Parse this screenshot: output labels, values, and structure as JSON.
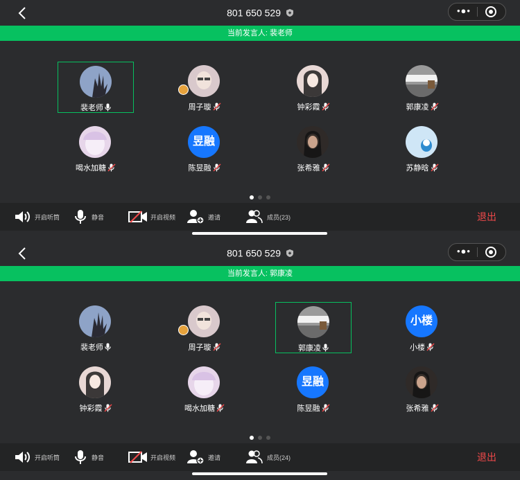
{
  "screens": [
    {
      "meeting_id": "801 650 529",
      "speaker_text": "当前发言人: 裴老师",
      "participants": [
        {
          "name": "裴老师",
          "mic": "on",
          "active": true,
          "avatar": "photo-hand",
          "color": "#8ea3c7"
        },
        {
          "name": "周子璇",
          "mic": "off",
          "active": false,
          "avatar": "photo-girl",
          "color": "#d9c9cc",
          "badge": true
        },
        {
          "name": "钟彩霞",
          "mic": "off",
          "active": false,
          "avatar": "photo-drawn-girl",
          "color": "#e8d8d5"
        },
        {
          "name": "郭康凌",
          "mic": "off",
          "active": false,
          "avatar": "photo-gray",
          "color": "#9a9a9a"
        },
        {
          "name": "喝水加糖",
          "mic": "off",
          "active": false,
          "avatar": "photo-anime",
          "color": "#e7d6ea"
        },
        {
          "name": "陈昱融",
          "mic": "off",
          "active": false,
          "avatar": "text",
          "avatar_text": "昱融"
        },
        {
          "name": "张希雅",
          "mic": "off",
          "active": false,
          "avatar": "photo-dark",
          "color": "#2f2a28"
        },
        {
          "name": "苏静晗",
          "mic": "off",
          "active": false,
          "avatar": "photo-cartoon",
          "color": "#cfe6f6"
        }
      ],
      "toolbar": {
        "speaker_label": "开启听筒",
        "mute_label": "静音",
        "video_label": "开启视频",
        "invite_label": "邀请",
        "members_label": "成员(23)",
        "exit_label": "退出"
      }
    },
    {
      "meeting_id": "801 650 529",
      "speaker_text": "当前发言人: 郭康凌",
      "participants": [
        {
          "name": "裴老师",
          "mic": "on",
          "active": false,
          "avatar": "photo-hand",
          "color": "#8ea3c7"
        },
        {
          "name": "周子璇",
          "mic": "off",
          "active": false,
          "avatar": "photo-girl",
          "color": "#d9c9cc",
          "badge": true
        },
        {
          "name": "郭康凌",
          "mic": "on",
          "active": true,
          "avatar": "photo-gray",
          "color": "#9a9a9a"
        },
        {
          "name": "小楼",
          "mic": "off",
          "active": false,
          "avatar": "text",
          "avatar_text": "小楼"
        },
        {
          "name": "钟彩霞",
          "mic": "off",
          "active": false,
          "avatar": "photo-drawn-girl",
          "color": "#e8d8d5"
        },
        {
          "name": "喝水加糖",
          "mic": "off",
          "active": false,
          "avatar": "photo-anime",
          "color": "#e7d6ea"
        },
        {
          "name": "陈昱融",
          "mic": "off",
          "active": false,
          "avatar": "text",
          "avatar_text": "昱融"
        },
        {
          "name": "张希雅",
          "mic": "off",
          "active": false,
          "avatar": "photo-dark",
          "color": "#2f2a28"
        }
      ],
      "toolbar": {
        "speaker_label": "开启听筒",
        "mute_label": "静音",
        "video_label": "开启视频",
        "invite_label": "邀请",
        "members_label": "成员(24)",
        "exit_label": "退出"
      }
    }
  ],
  "colors": {
    "accent": "#07c160",
    "exit": "#f1494a",
    "background": "#2b2c2e"
  }
}
